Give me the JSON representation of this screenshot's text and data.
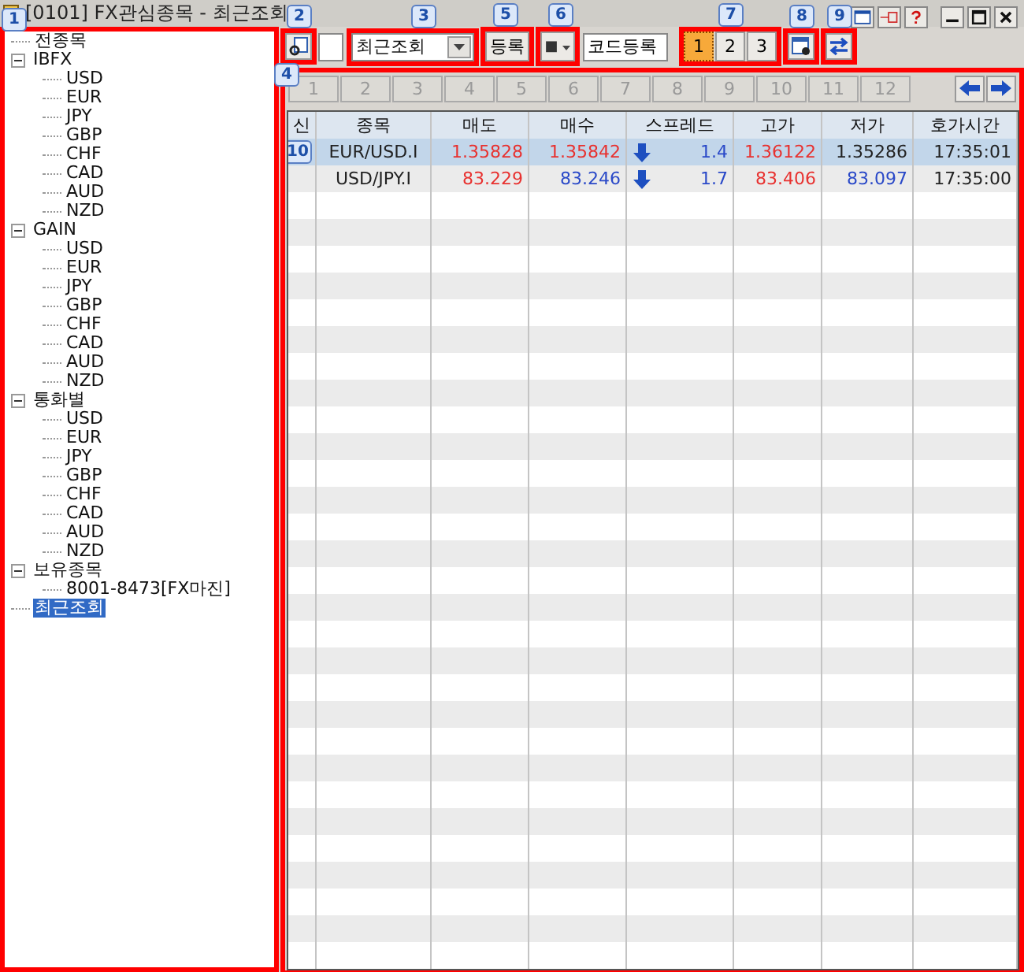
{
  "window": {
    "title": "[0101] FX관심종목 - 최근조회"
  },
  "tree": {
    "marker": "1",
    "items": [
      {
        "label": "전종목",
        "selected": false
      },
      {
        "label": "IBFX",
        "expanded": true,
        "selected": false,
        "children": [
          {
            "label": "USD",
            "selected": false
          },
          {
            "label": "EUR",
            "selected": false
          },
          {
            "label": "JPY",
            "selected": false
          },
          {
            "label": "GBP",
            "selected": false
          },
          {
            "label": "CHF",
            "selected": false
          },
          {
            "label": "CAD",
            "selected": false
          },
          {
            "label": "AUD",
            "selected": false
          },
          {
            "label": "NZD",
            "selected": false
          }
        ]
      },
      {
        "label": "GAIN",
        "expanded": true,
        "selected": false,
        "children": [
          {
            "label": "USD",
            "selected": false
          },
          {
            "label": "EUR",
            "selected": false
          },
          {
            "label": "JPY",
            "selected": false
          },
          {
            "label": "GBP",
            "selected": false
          },
          {
            "label": "CHF",
            "selected": false
          },
          {
            "label": "CAD",
            "selected": false
          },
          {
            "label": "AUD",
            "selected": false
          },
          {
            "label": "NZD",
            "selected": false
          }
        ]
      },
      {
        "label": "통화별",
        "expanded": true,
        "selected": false,
        "children": [
          {
            "label": "USD",
            "selected": false
          },
          {
            "label": "EUR",
            "selected": false
          },
          {
            "label": "JPY",
            "selected": false
          },
          {
            "label": "GBP",
            "selected": false
          },
          {
            "label": "CHF",
            "selected": false
          },
          {
            "label": "CAD",
            "selected": false
          },
          {
            "label": "AUD",
            "selected": false
          },
          {
            "label": "NZD",
            "selected": false
          }
        ]
      },
      {
        "label": "보유종목",
        "expanded": true,
        "selected": false,
        "children": [
          {
            "label": "8001-8473[FX마진]",
            "selected": false
          }
        ]
      },
      {
        "label": "최근조회",
        "selected": true
      }
    ]
  },
  "toolbar": {
    "search_marker": "2",
    "group_combo": {
      "value": "최근조회",
      "marker": "3"
    },
    "register_button": {
      "label": "등록",
      "marker": "5"
    },
    "color_picker": {
      "symbol": "■",
      "marker": "6"
    },
    "code_field": {
      "value": "코드등록"
    },
    "pages": {
      "marker": "7",
      "items": [
        {
          "label": "1",
          "selected": true
        },
        {
          "label": "2",
          "selected": false
        },
        {
          "label": "3",
          "selected": false
        }
      ]
    },
    "settings_marker": "8",
    "swap_marker": "9"
  },
  "group_tabs": {
    "marker": "4",
    "items": [
      {
        "label": "1",
        "selected": false
      },
      {
        "label": "2",
        "selected": false
      },
      {
        "label": "3",
        "selected": false
      },
      {
        "label": "4",
        "selected": false
      },
      {
        "label": "5",
        "selected": false
      },
      {
        "label": "6",
        "selected": false
      },
      {
        "label": "7",
        "selected": false
      },
      {
        "label": "8",
        "selected": false
      },
      {
        "label": "9",
        "selected": false
      },
      {
        "label": "10",
        "selected": false
      },
      {
        "label": "11",
        "selected": false
      },
      {
        "label": "12",
        "selected": false
      }
    ]
  },
  "table": {
    "columns": [
      "신",
      "종목",
      "매도",
      "매수",
      "스프레드",
      "고가",
      "저가",
      "호가시간"
    ],
    "rows": [
      {
        "selected": true,
        "marker": "10",
        "cells": [
          {
            "text": ""
          },
          {
            "text": "EUR/USD.I",
            "color": "#222222"
          },
          {
            "text": "1.35828",
            "color": "#e8312f"
          },
          {
            "text": "1.35842",
            "color": "#e8312f"
          },
          {
            "text": "1.4",
            "color": "#2a49c8",
            "falling": true
          },
          {
            "text": "1.36122",
            "color": "#e8312f"
          },
          {
            "text": "1.35286",
            "color": "#222222"
          },
          {
            "text": "17:35:01",
            "color": "#222222"
          }
        ]
      },
      {
        "selected": false,
        "cells": [
          {
            "text": ""
          },
          {
            "text": "USD/JPY.I",
            "color": "#222222"
          },
          {
            "text": "83.229",
            "color": "#e8312f"
          },
          {
            "text": "83.246",
            "color": "#2a49c8"
          },
          {
            "text": "1.7",
            "color": "#2a49c8",
            "falling": true
          },
          {
            "text": "83.406",
            "color": "#e8312f"
          },
          {
            "text": "83.097",
            "color": "#2a49c8"
          },
          {
            "text": "17:35:00",
            "color": "#222222"
          }
        ]
      }
    ]
  }
}
